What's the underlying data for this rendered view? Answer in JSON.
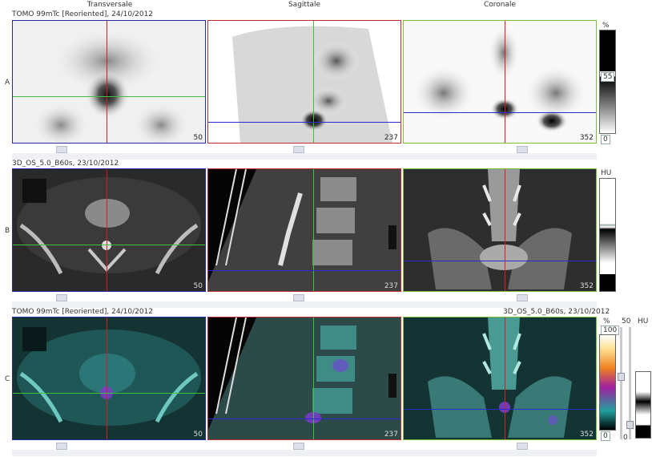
{
  "columns": {
    "transverse": "Transversale",
    "sagittal": "Sagittale",
    "coronal": "Coronale"
  },
  "rows": {
    "a": {
      "label": "A",
      "header": "TOMO 99mTc [Reoriented], 24/10/2012"
    },
    "b": {
      "label": "B",
      "header": "3D_OS_5.0_B60s, 23/10/2012"
    },
    "c": {
      "label": "C",
      "header_left": "TOMO 99mTc [Reoriented], 24/10/2012",
      "header_right": "3D_OS_5.0_B60s, 23/10/2012"
    }
  },
  "slices": {
    "transverse": "50",
    "sagittal": "237",
    "coronal": "352"
  },
  "scales": {
    "a": {
      "unit": "%",
      "mid": "55",
      "min": "0"
    },
    "b": {
      "unit": "HU"
    },
    "c": {
      "unit_left": "%",
      "max_left": "100",
      "min_left": "0",
      "unit_mid": "50",
      "unit_right": "HU",
      "min_right": "0"
    }
  },
  "colors": {
    "transverse_border": "#2a2a9a",
    "sagittal_border": "#c03030",
    "coronal_border": "#7ac03a",
    "crosshair_red": "#d02020",
    "crosshair_green": "#40c040",
    "crosshair_blue": "#2a2ad0"
  }
}
